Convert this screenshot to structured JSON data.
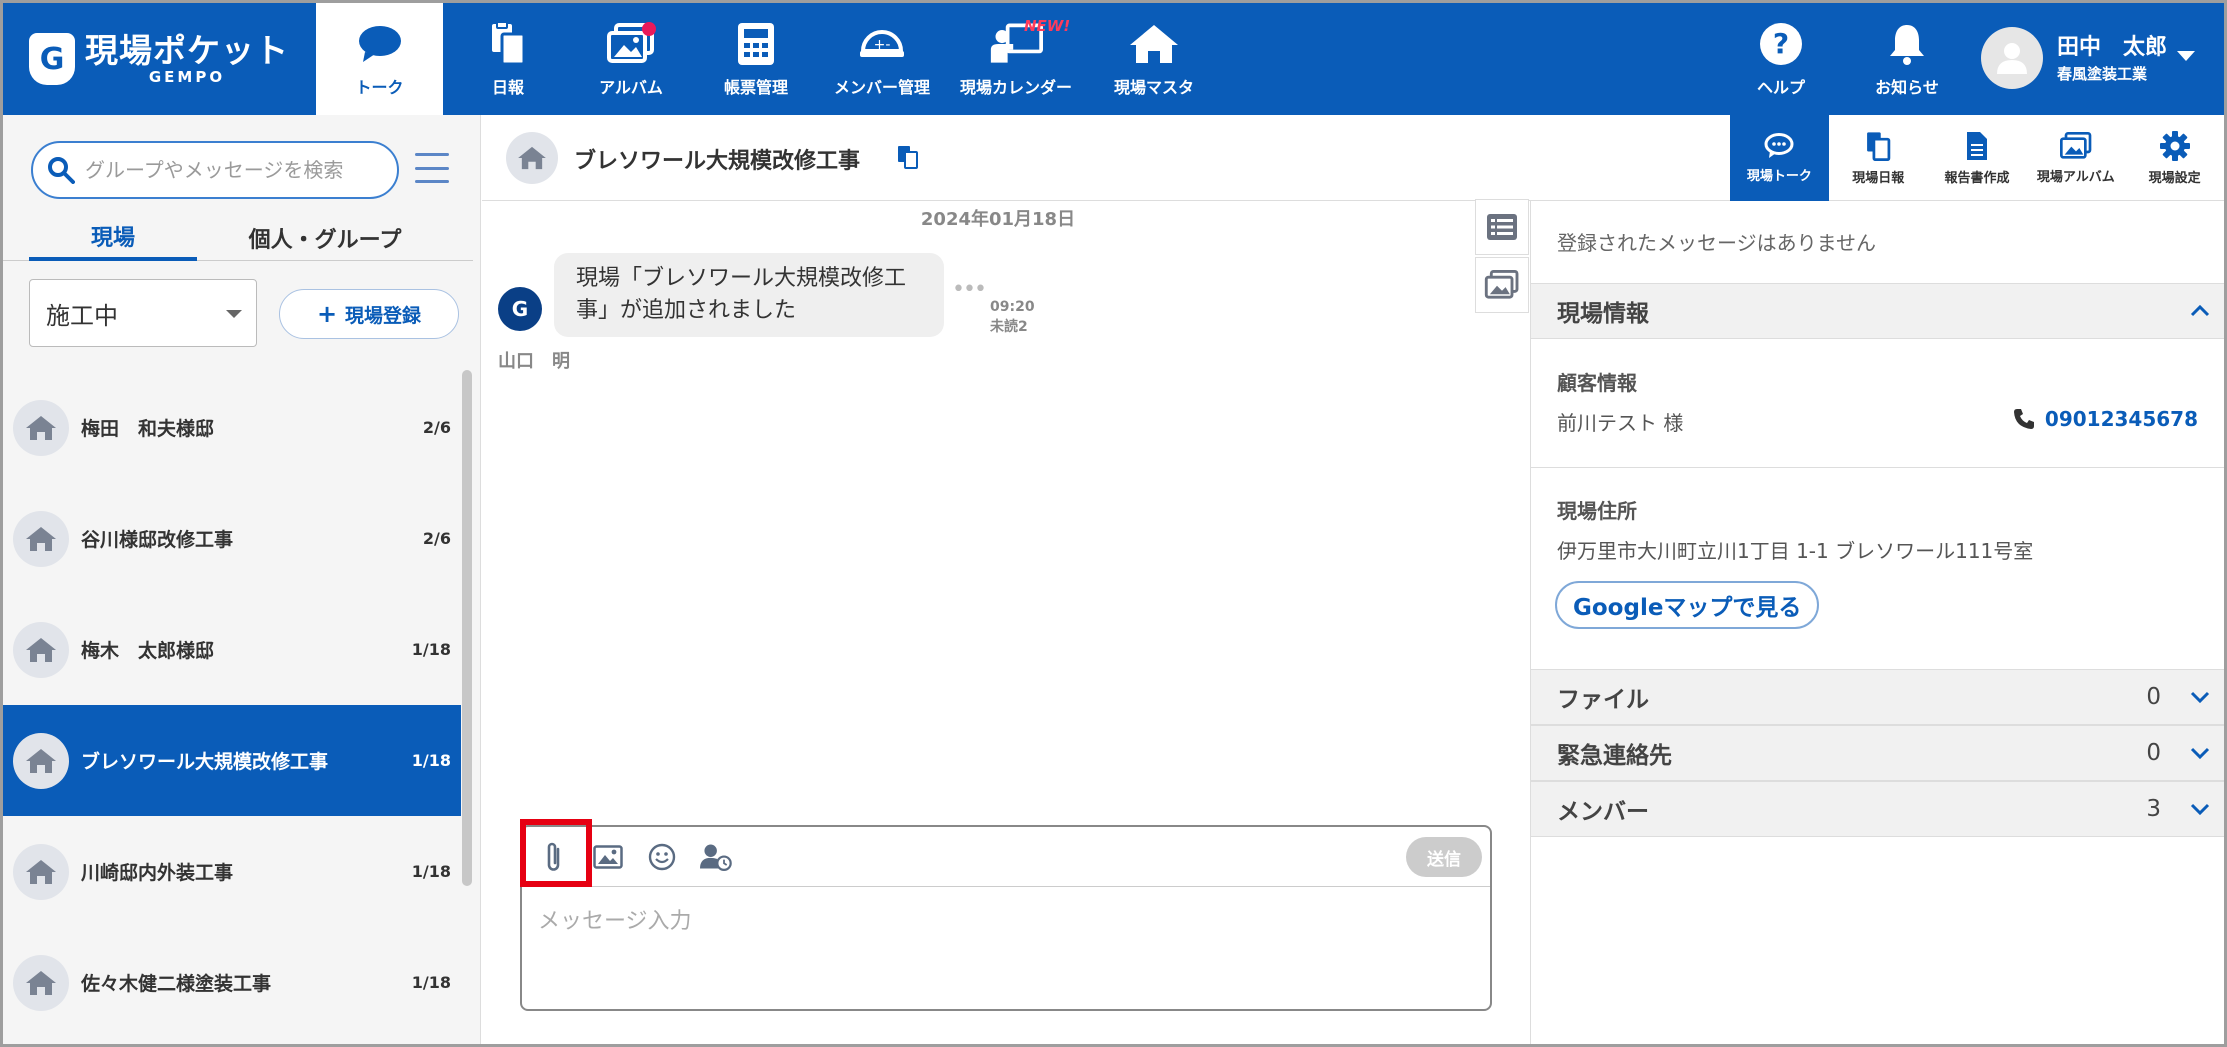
{
  "app": {
    "logo_main": "現場ポケット",
    "logo_sub": "GEMPO",
    "logo_mark": "G"
  },
  "header": {
    "nav": [
      {
        "label": "トーク",
        "icon": "chat-bubble-icon",
        "active": true
      },
      {
        "label": "日報",
        "icon": "documents-icon",
        "active": false
      },
      {
        "label": "アルバム",
        "icon": "album-icon",
        "active": false,
        "notification_dot": true
      },
      {
        "label": "帳票管理",
        "icon": "calculator-icon",
        "active": false
      },
      {
        "label": "メンバー管理",
        "icon": "hardhat-icon",
        "active": false
      },
      {
        "label": "現場カレンダー",
        "icon": "calendar-presenter-icon",
        "active": false
      },
      {
        "label": "現場マスタ",
        "icon": "house-icon",
        "active": false
      }
    ],
    "new_badge": "NEW!",
    "help_label": "ヘルプ",
    "notice_label": "お知らせ",
    "user_name": "田中　太郎",
    "user_company": "春風塗装工業"
  },
  "sidebar": {
    "search_placeholder": "グループやメッセージを検索",
    "tabs": [
      {
        "label": "現場",
        "active": true
      },
      {
        "label": "個人・グループ",
        "active": false
      }
    ],
    "status_filter": "施工中",
    "add_site_label": "現場登録",
    "sites": [
      {
        "name": "梅田　和夫様邸",
        "count": "2/6",
        "active": false
      },
      {
        "name": "谷川様邸改修工事",
        "count": "2/6",
        "active": false
      },
      {
        "name": "梅木　太郎様邸",
        "count": "1/18",
        "active": false
      },
      {
        "name": "ブレソワール大規模改修工事",
        "count": "1/18",
        "active": true
      },
      {
        "name": "川崎邸内外装工事",
        "count": "1/18",
        "active": false
      },
      {
        "name": "佐々木健二様塗装工事",
        "count": "1/18",
        "active": false
      }
    ]
  },
  "chat": {
    "title": "ブレソワール大規模改修工事",
    "date": "2024年01月18日",
    "message": {
      "avatar_letter": "G",
      "text": "現場「ブレソワール大規模改修工事」が追加されました",
      "time": "09:20",
      "unread": "未読2",
      "sender": "山口　明"
    },
    "composer": {
      "placeholder": "メッセージ入力",
      "send_label": "送信"
    }
  },
  "right_tabs": [
    {
      "label": "現場トーク",
      "icon": "chat-bubble-icon",
      "active": true
    },
    {
      "label": "現場日報",
      "icon": "documents-icon",
      "active": false
    },
    {
      "label": "報告書作成",
      "icon": "report-icon",
      "active": false
    },
    {
      "label": "現場アルバム",
      "icon": "album-icon",
      "active": false
    },
    {
      "label": "現場設定",
      "icon": "gear-icon",
      "active": false
    }
  ],
  "info": {
    "no_messages": "登録されたメッセージはありません",
    "site_info_title": "現場情報",
    "customer_label": "顧客情報",
    "customer_name": "前川テスト 様",
    "phone": "09012345678",
    "address_label": "現場住所",
    "address": "伊万里市大川町立川1丁目 1-1 ブレソワール111号室",
    "map_button": "Googleマップで見る",
    "sections": [
      {
        "label": "ファイル",
        "count": "0"
      },
      {
        "label": "緊急連絡先",
        "count": "0"
      },
      {
        "label": "メンバー",
        "count": "3"
      }
    ]
  },
  "colors": {
    "brand": "#0a5cb8",
    "highlight": "#e60012",
    "notification": "#e8195a"
  }
}
